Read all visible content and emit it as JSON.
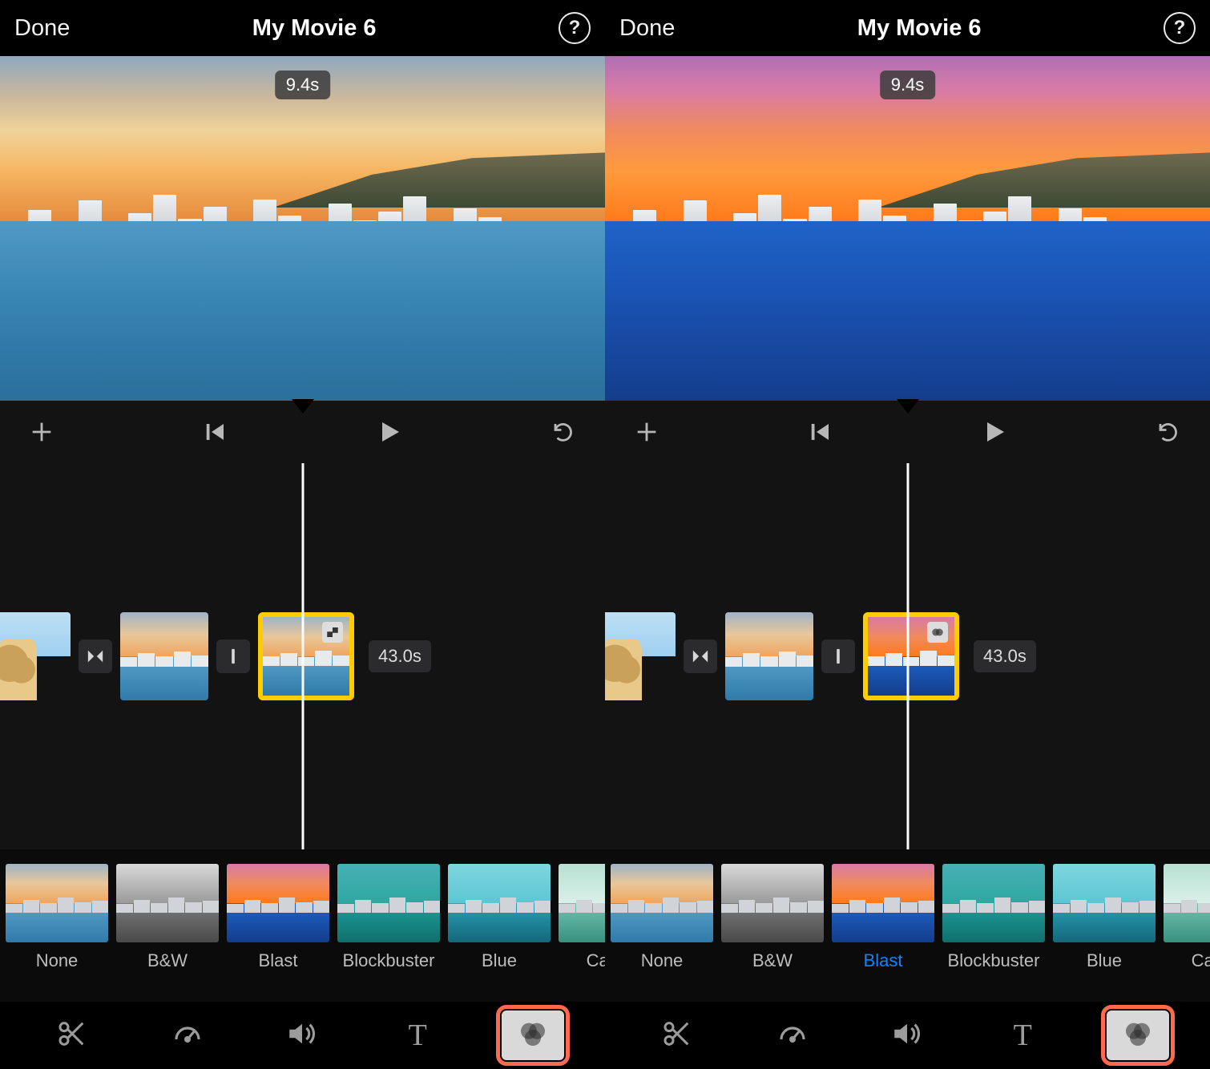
{
  "header": {
    "done": "Done",
    "title": "My Movie 6",
    "help": "?"
  },
  "preview": {
    "duration_badge": "9.4s"
  },
  "toolbar": {
    "add": "add",
    "rewind": "rewind",
    "play": "play",
    "undo": "undo"
  },
  "timeline": {
    "total_duration": "43.0s"
  },
  "filters": [
    {
      "id": "none",
      "label": "None",
      "sky": "skN",
      "sea": "seN"
    },
    {
      "id": "bw",
      "label": "B&W",
      "sky": "skBW",
      "sea": "seBW"
    },
    {
      "id": "blast",
      "label": "Blast",
      "sky": "skBL",
      "sea": "seBL"
    },
    {
      "id": "blockbuster",
      "label": "Blockbuster",
      "sky": "skBB",
      "sea": "seBB"
    },
    {
      "id": "blue",
      "label": "Blue",
      "sky": "skBU",
      "sea": "seBU"
    },
    {
      "id": "camo",
      "label": "Camo",
      "sky": "skCA",
      "sea": "seCA"
    }
  ],
  "selected_filter": {
    "left": null,
    "right": "blast"
  },
  "tools": [
    {
      "id": "cut",
      "icon": "scissors"
    },
    {
      "id": "speed",
      "icon": "gauge"
    },
    {
      "id": "volume",
      "icon": "speaker"
    },
    {
      "id": "text",
      "icon": "T"
    },
    {
      "id": "filters",
      "icon": "overlap",
      "active": true,
      "highlight": true
    }
  ],
  "icons": {
    "scissors": "scissors-icon",
    "gauge": "gauge-icon",
    "speaker": "speaker-icon",
    "T": "text-icon",
    "overlap": "filters-icon",
    "dissolve": "dissolve-icon",
    "none-trans": "none-transition-icon"
  }
}
